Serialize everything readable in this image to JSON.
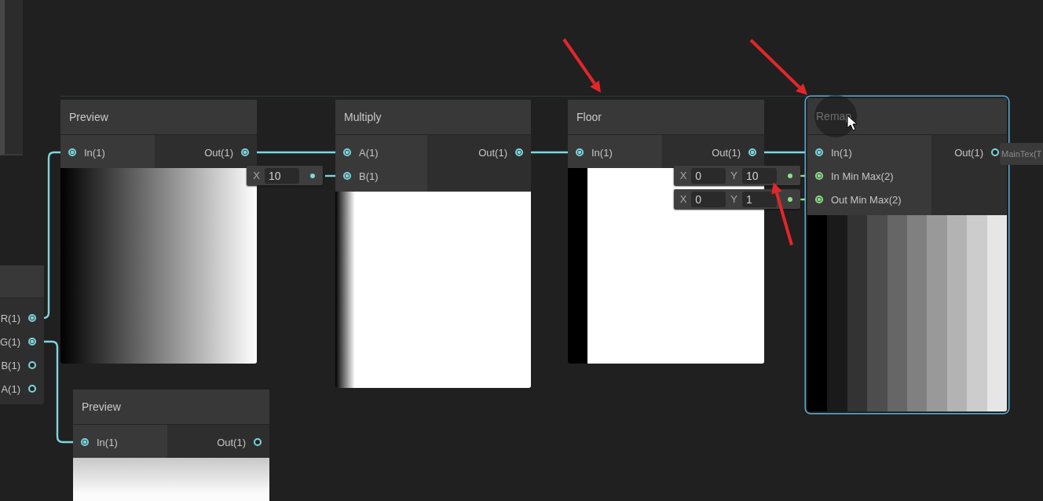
{
  "canvas": {
    "nodes": [
      {
        "title": "Preview",
        "selected": false,
        "inputs": [
          {
            "label": "In(1)",
            "connected": true,
            "color": "#7fd6df"
          }
        ],
        "outputs": [
          {
            "label": "Out(1)",
            "connected": true,
            "color": "#7fd6df"
          }
        ],
        "preview": {
          "kind": "ramp"
        }
      },
      {
        "title": "Multiply",
        "selected": false,
        "inputs": [
          {
            "label": "A(1)",
            "connected": true,
            "color": "#7fd6df"
          },
          {
            "label": "B(1)",
            "connected": true,
            "color": "#7fd6df",
            "fields": [
              {
                "axis": "X",
                "value": "10"
              }
            ]
          }
        ],
        "outputs": [
          {
            "label": "Out(1)",
            "connected": true,
            "color": "#7fd6df"
          }
        ],
        "preview": {
          "kind": "edge"
        }
      },
      {
        "title": "Floor",
        "selected": false,
        "inputs": [
          {
            "label": "In(1)",
            "connected": true,
            "color": "#7fd6df"
          }
        ],
        "outputs": [
          {
            "label": "Out(1)",
            "connected": true,
            "color": "#7fd6df"
          }
        ],
        "preview": {
          "kind": "step"
        }
      },
      {
        "title": "Remap",
        "selected": true,
        "inputs": [
          {
            "label": "In(1)",
            "connected": true,
            "color": "#7fd6df"
          },
          {
            "label": "In Min Max(2)",
            "connected": true,
            "color": "#8ee08c",
            "fields": [
              {
                "axis": "X",
                "value": "0"
              },
              {
                "axis": "Y",
                "value": "10"
              }
            ]
          },
          {
            "label": "Out Min Max(2)",
            "connected": true,
            "color": "#8ee08c",
            "fields": [
              {
                "axis": "X",
                "value": "0"
              },
              {
                "axis": "Y",
                "value": "1"
              }
            ]
          }
        ],
        "outputs": [
          {
            "label": "Out(1)",
            "connected": false,
            "color": "#7fd6df"
          }
        ],
        "preview": {
          "kind": "bands"
        }
      },
      {
        "selected": false,
        "outputs": [
          {
            "label": "R(1)",
            "connected": true,
            "color": "#7fd6df"
          },
          {
            "label": "G(1)",
            "connected": true,
            "color": "#7fd6df"
          },
          {
            "label": "B(1)",
            "connected": false,
            "color": "#7fd6df"
          },
          {
            "label": "A(1)",
            "connected": false,
            "color": "#7fd6df"
          }
        ]
      },
      {
        "title": "Preview",
        "selected": false,
        "inputs": [
          {
            "label": "In(1)",
            "connected": true,
            "color": "#7fd6df"
          }
        ],
        "outputs": [
          {
            "label": "Out(1)",
            "connected": false,
            "color": "#7fd6df"
          }
        ],
        "preview": {
          "kind": "fade"
        }
      }
    ],
    "floating_port": {
      "label": "MainTex(T"
    }
  }
}
